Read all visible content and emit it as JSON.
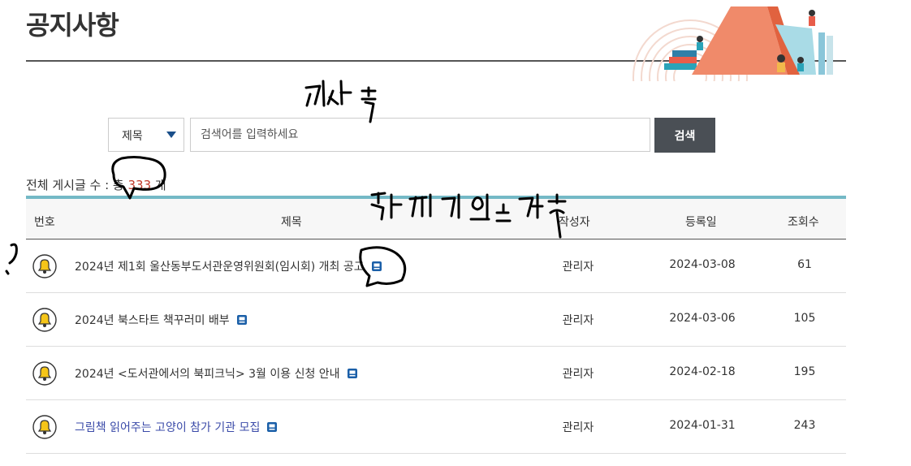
{
  "page": {
    "title": "공지사항"
  },
  "search": {
    "field_select": "제목",
    "placeholder": "검색어를 입력하세요",
    "button_label": "검색"
  },
  "summary": {
    "prefix": "전체 게시글 수 : 총 ",
    "count": "333",
    "suffix": " 개"
  },
  "table": {
    "headers": {
      "number": "번호",
      "subject": "제목",
      "author": "작성자",
      "date": "등록일",
      "views": "조회수"
    },
    "rows": [
      {
        "subject": "2024년 제1회 울산동부도서관운영위원회(임시회) 개최 공고",
        "author": "관리자",
        "date": "2024-03-08",
        "views": "61",
        "attachment": true
      },
      {
        "subject": "2024년 북스타트 책꾸러미 배부",
        "author": "관리자",
        "date": "2024-03-06",
        "views": "105",
        "attachment": true
      },
      {
        "subject": "2024년 <도서관에서의 북피크닉> 3월 이용 신청 안내",
        "author": "관리자",
        "date": "2024-02-18",
        "views": "195",
        "attachment": true
      },
      {
        "subject": "그림책 읽어주는 고양이 참가 기관 모집",
        "author": "관리자",
        "date": "2024-01-31",
        "views": "243",
        "attachment": true
      }
    ]
  },
  "icons": {
    "notice": "bell-icon",
    "attachment": "file-attachment-icon"
  },
  "colors": {
    "accent_count": "#c0392b",
    "header_line": "#74b9c6",
    "button_bg": "#4a4f55",
    "bell_fill": "#f5c518"
  }
}
